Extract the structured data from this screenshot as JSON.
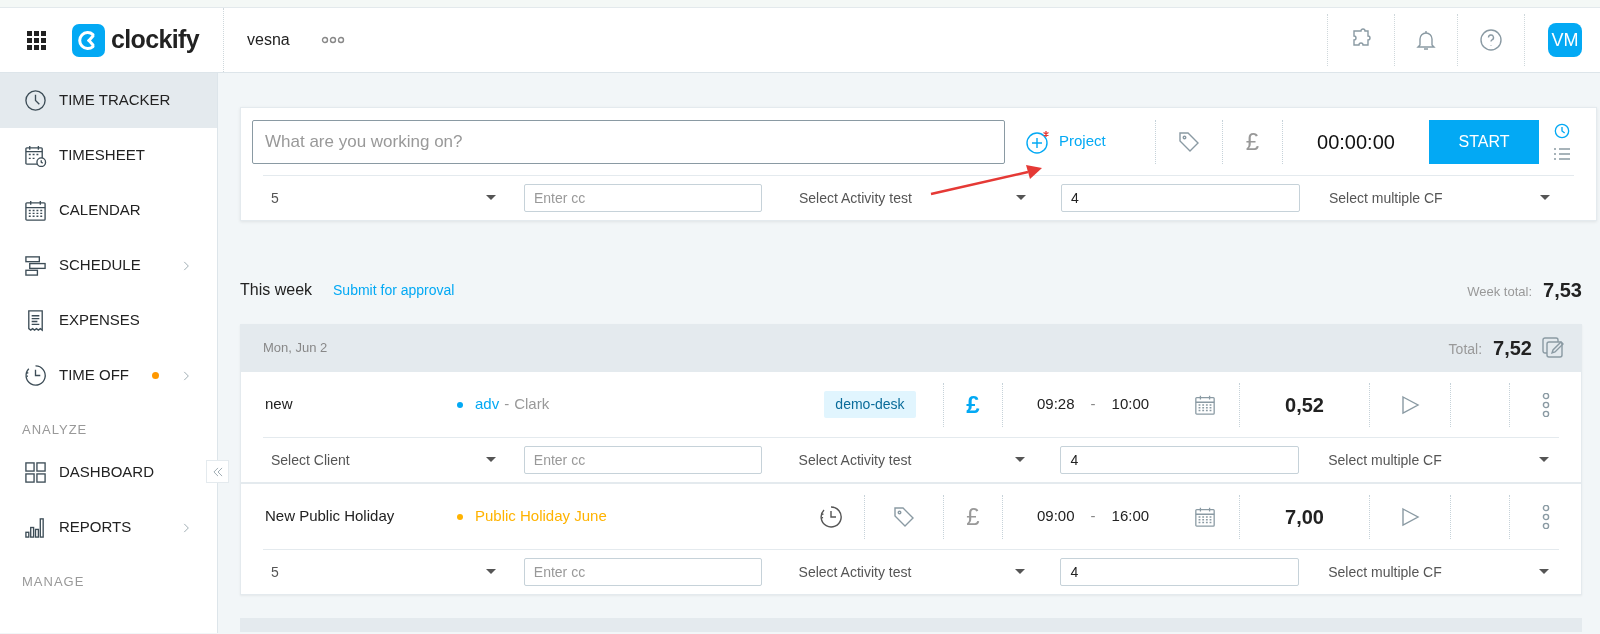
{
  "header": {
    "logo": "clockify",
    "workspace": "vesna",
    "avatar": "VM"
  },
  "sidebar": {
    "sections": [
      {
        "items": [
          {
            "label": "TIME TRACKER",
            "selected": true,
            "has_submenu": false,
            "badge_dot": false
          },
          {
            "label": "TIMESHEET",
            "selected": false,
            "has_submenu": false,
            "badge_dot": false
          },
          {
            "label": "CALENDAR",
            "selected": false,
            "has_submenu": false,
            "badge_dot": false
          },
          {
            "label": "SCHEDULE",
            "selected": false,
            "has_submenu": true,
            "badge_dot": false
          },
          {
            "label": "EXPENSES",
            "selected": false,
            "has_submenu": false,
            "badge_dot": false
          },
          {
            "label": "TIME OFF",
            "selected": false,
            "has_submenu": true,
            "badge_dot": true
          }
        ]
      },
      {
        "heading": "ANALYZE",
        "items": [
          {
            "label": "DASHBOARD",
            "selected": false,
            "has_submenu": false,
            "badge_dot": false
          },
          {
            "label": "REPORTS",
            "selected": false,
            "has_submenu": true,
            "badge_dot": false
          }
        ]
      },
      {
        "heading": "MANAGE"
      }
    ]
  },
  "tracker": {
    "placeholder": "What are you working on?",
    "project": "Project",
    "currency": "£",
    "timer": "00:00:00",
    "button": "START",
    "fields": [
      {
        "kind": "select",
        "value": "5"
      },
      {
        "kind": "input",
        "placeholder": "Enter cc"
      },
      {
        "kind": "select",
        "value": "Select Activity test"
      },
      {
        "kind": "input",
        "value": "4"
      },
      {
        "kind": "select",
        "value": "Select multiple CF"
      }
    ]
  },
  "week": {
    "title": "This week",
    "link": "Submit for approval",
    "total_label": "Week total:",
    "total": "7,53"
  },
  "days": [
    {
      "date": "Mon, Jun 2",
      "total_label": "Total:",
      "total": "7,52",
      "entries": [
        {
          "description": "new",
          "project": "adv",
          "client_separator": "-",
          "client": "Clark",
          "color": "#03a9f4",
          "tags": [
            "demo-desk"
          ],
          "time_off": false,
          "billable": true,
          "currency": "£",
          "start": "09:28",
          "separator": "-",
          "end": "10:00",
          "duration": "0,52",
          "fields": [
            {
              "kind": "select",
              "value": "Select Client"
            },
            {
              "kind": "input",
              "placeholder": "Enter cc"
            },
            {
              "kind": "select",
              "value": "Select Activity test"
            },
            {
              "kind": "input",
              "value": "4"
            },
            {
              "kind": "select",
              "value": "Select multiple CF"
            }
          ]
        },
        {
          "description": "New Public Holiday",
          "project": "Public Holiday June",
          "color": "#ffb300",
          "time_off": true,
          "billable": false,
          "currency": "£",
          "start": "09:00",
          "separator": "-",
          "end": "16:00",
          "duration": "7,00",
          "fields": [
            {
              "kind": "select",
              "value": "5"
            },
            {
              "kind": "input",
              "placeholder": "Enter cc"
            },
            {
              "kind": "select",
              "value": "Select Activity test"
            },
            {
              "kind": "input",
              "value": "4"
            },
            {
              "kind": "select",
              "value": "Select multiple CF"
            }
          ]
        }
      ]
    }
  ]
}
